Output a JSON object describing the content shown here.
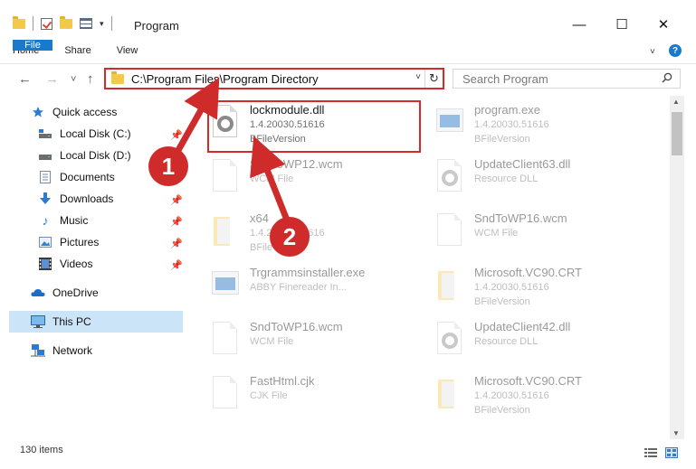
{
  "window": {
    "title": "Program",
    "minimize_glyph": "—",
    "maximize_glyph": "☐",
    "close_glyph": "✕"
  },
  "ribbon": {
    "tabs": [
      "File",
      "Home",
      "Share",
      "View"
    ],
    "help_glyph": "?",
    "collapse_glyph": "˅"
  },
  "navigation": {
    "back_glyph": "←",
    "forward_glyph": "→",
    "recent_glyph": "˅",
    "up_glyph": "↑",
    "address": "C:\\Program Files\\Program Directory",
    "address_dropdown_glyph": "˅",
    "refresh_glyph": "↻",
    "search_placeholder": "Search Program"
  },
  "sidebar": {
    "items": [
      {
        "label": "Quick access",
        "icon": "star-icon",
        "pinned": false
      },
      {
        "label": "Local Disk (C:)",
        "icon": "drive-icon",
        "pinned": true
      },
      {
        "label": "Local Disk (D:)",
        "icon": "drive-icon",
        "pinned": false
      },
      {
        "label": "Documents",
        "icon": "documents-icon",
        "pinned": true
      },
      {
        "label": "Downloads",
        "icon": "download-icon",
        "pinned": true
      },
      {
        "label": "Music",
        "icon": "music-icon",
        "pinned": true
      },
      {
        "label": "Pictures",
        "icon": "pictures-icon",
        "pinned": true
      },
      {
        "label": "Videos",
        "icon": "videos-icon",
        "pinned": true
      },
      {
        "label": "OneDrive",
        "icon": "cloud-icon",
        "pinned": false
      },
      {
        "label": "This PC",
        "icon": "computer-icon",
        "pinned": false,
        "selected": true
      },
      {
        "label": "Network",
        "icon": "network-icon",
        "pinned": false
      }
    ],
    "pin_glyph": "📌"
  },
  "files": [
    {
      "name": "lockmodule.dll",
      "line2": "1.4.20030.51616",
      "line3": "BFileVersion",
      "icon": "gear-file-icon",
      "highlighted": true
    },
    {
      "name": "program.exe",
      "line2": "1.4.20030.51616",
      "line3": "BFileVersion",
      "icon": "exe-icon"
    },
    {
      "name": "SndToWP12.wcm",
      "line2": "WCM File",
      "line3": "",
      "icon": "document-icon"
    },
    {
      "name": "UpdateClient63.dll",
      "line2": "Resource DLL",
      "line3": "",
      "icon": "gear-file-icon"
    },
    {
      "name": "x64",
      "line2": "1.4.20030.51616",
      "line3": "BFileVersion",
      "icon": "folder-file-icon"
    },
    {
      "name": "SndToWP16.wcm",
      "line2": "WCM File",
      "line3": "",
      "icon": "document-icon"
    },
    {
      "name": "Trgrammsinstaller.exe",
      "line2": "ABBY Finereader In...",
      "line3": "",
      "icon": "exe-icon"
    },
    {
      "name": "Microsoft.VC90.CRT",
      "line2": "1.4.20030.51616",
      "line3": "BFileVersion",
      "icon": "folder-file-icon"
    },
    {
      "name": "SndToWP16.wcm",
      "line2": "WCM File",
      "line3": "",
      "icon": "document-icon"
    },
    {
      "name": "UpdateClient42.dll",
      "line2": "Resource DLL",
      "line3": "",
      "icon": "gear-file-icon"
    },
    {
      "name": "FastHtml.cjk",
      "line2": "CJK File",
      "line3": "",
      "icon": "document-icon"
    },
    {
      "name": "Microsoft.VC90.CRT",
      "line2": "1.4.20030.51616",
      "line3": "BFileVersion",
      "icon": "folder-file-icon"
    }
  ],
  "annotations": {
    "marker_1": "1",
    "marker_2": "2",
    "color": "#cf2b2b"
  },
  "status": {
    "item_count": "130 items"
  },
  "colors": {
    "accent": "#1979ca",
    "selection": "#cce4f7",
    "highlight_border": "#d32b2b"
  }
}
